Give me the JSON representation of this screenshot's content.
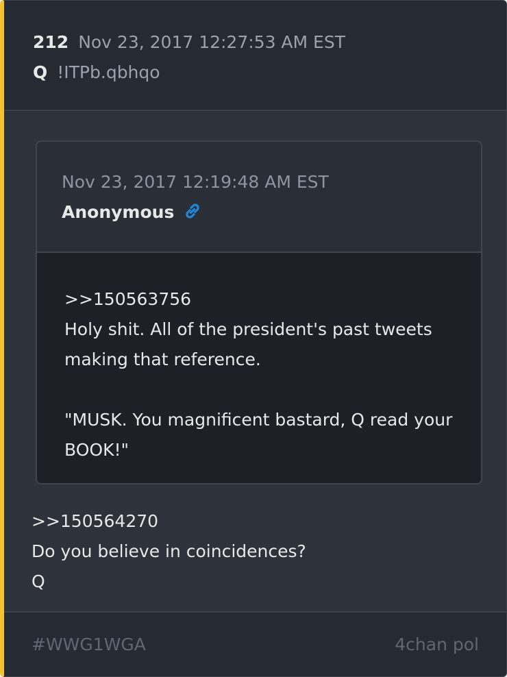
{
  "post": {
    "number": "212",
    "timestamp": "Nov 23, 2017 12:27:53 AM EST",
    "author": "Q",
    "tripcode": "!ITPb.qbhqo"
  },
  "quoted_post": {
    "timestamp": "Nov 23, 2017 12:19:48 AM EST",
    "author": "Anonymous",
    "link_icon": "link-icon",
    "lines": [
      ">>150563756",
      "Holy shit. All of the president's past tweets making that reference.",
      "\"MUSK. You magnificent bastard, Q read your BOOK!\""
    ]
  },
  "body": {
    "lines": [
      ">>150564270",
      "Do you believe in coincidences?",
      "Q"
    ]
  },
  "footer": {
    "hashtag": "#WWG1WGA",
    "source": "4chan pol"
  },
  "colors": {
    "accent": "#f2c230",
    "link": "#1e88d6"
  }
}
